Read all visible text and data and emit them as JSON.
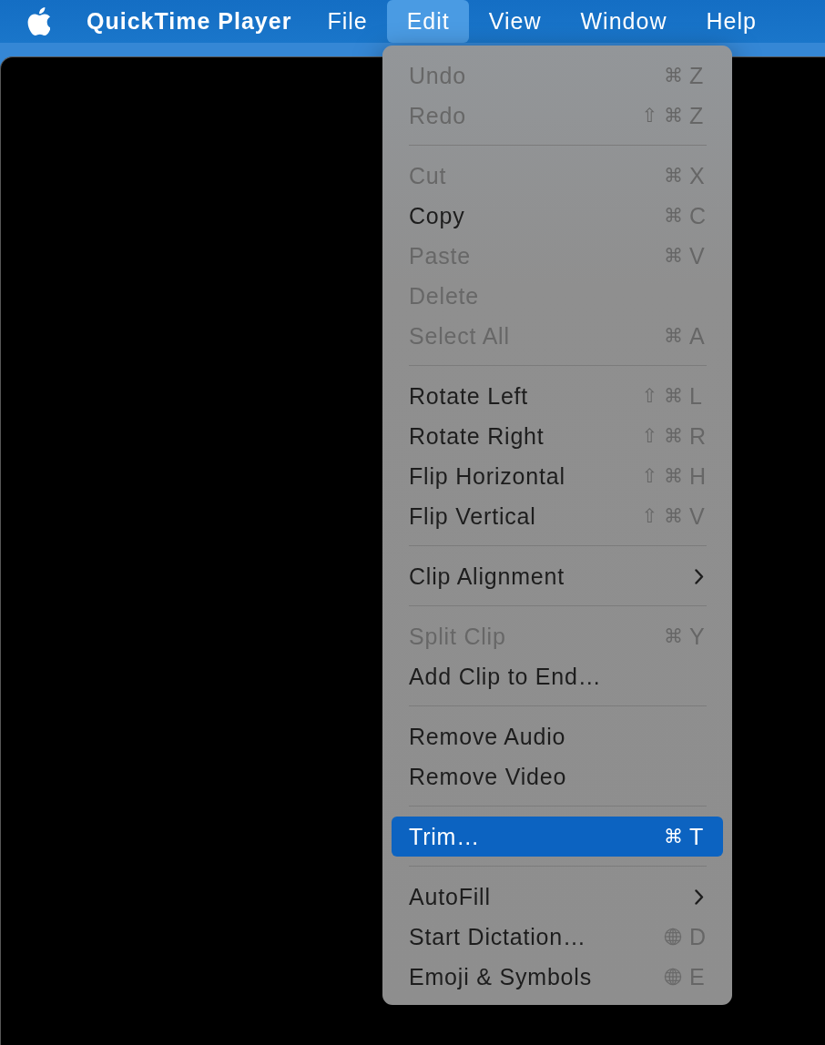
{
  "menu_bar": {
    "app_name": "QuickTime Player",
    "menus": [
      {
        "label": "File",
        "selected": false
      },
      {
        "label": "Edit",
        "selected": true
      },
      {
        "label": "View",
        "selected": false
      },
      {
        "label": "Window",
        "selected": false
      },
      {
        "label": "Help",
        "selected": false
      }
    ]
  },
  "edit_menu": {
    "groups": [
      {
        "items": [
          {
            "label": "Undo",
            "kind": "command",
            "disabled": true,
            "selected": false,
            "shortcut": {
              "kind": "modifiers",
              "modifiers": "⌘",
              "key": "Z"
            }
          },
          {
            "label": "Redo",
            "kind": "command",
            "disabled": true,
            "selected": false,
            "shortcut": {
              "kind": "modifiers",
              "modifiers": "⇧ ⌘",
              "key": "Z"
            }
          }
        ]
      },
      {
        "items": [
          {
            "label": "Cut",
            "kind": "command",
            "disabled": true,
            "selected": false,
            "shortcut": {
              "kind": "modifiers",
              "modifiers": "⌘",
              "key": "X"
            }
          },
          {
            "label": "Copy",
            "kind": "command",
            "disabled": false,
            "selected": false,
            "shortcut": {
              "kind": "modifiers",
              "modifiers": "⌘",
              "key": "C"
            }
          },
          {
            "label": "Paste",
            "kind": "command",
            "disabled": true,
            "selected": false,
            "shortcut": {
              "kind": "modifiers",
              "modifiers": "⌘",
              "key": "V"
            }
          },
          {
            "label": "Delete",
            "kind": "command",
            "disabled": true,
            "selected": false
          },
          {
            "label": "Select All",
            "kind": "command",
            "disabled": true,
            "selected": false,
            "shortcut": {
              "kind": "modifiers",
              "modifiers": "⌘",
              "key": "A"
            }
          }
        ]
      },
      {
        "items": [
          {
            "label": "Rotate Left",
            "kind": "command",
            "disabled": false,
            "selected": false,
            "shortcut": {
              "kind": "modifiers",
              "modifiers": "⇧ ⌘",
              "key": "L"
            }
          },
          {
            "label": "Rotate Right",
            "kind": "command",
            "disabled": false,
            "selected": false,
            "shortcut": {
              "kind": "modifiers",
              "modifiers": "⇧ ⌘",
              "key": "R"
            }
          },
          {
            "label": "Flip Horizontal",
            "kind": "command",
            "disabled": false,
            "selected": false,
            "shortcut": {
              "kind": "modifiers",
              "modifiers": "⇧ ⌘",
              "key": "H"
            }
          },
          {
            "label": "Flip Vertical",
            "kind": "command",
            "disabled": false,
            "selected": false,
            "shortcut": {
              "kind": "modifiers",
              "modifiers": "⇧ ⌘",
              "key": "V"
            }
          }
        ]
      },
      {
        "items": [
          {
            "label": "Clip Alignment",
            "kind": "submenu",
            "disabled": false,
            "selected": false
          }
        ]
      },
      {
        "items": [
          {
            "label": "Split Clip",
            "kind": "command",
            "disabled": true,
            "selected": false,
            "shortcut": {
              "kind": "modifiers",
              "modifiers": "⌘",
              "key": "Y"
            }
          },
          {
            "label": "Add Clip to End…",
            "kind": "command",
            "disabled": false,
            "selected": false
          }
        ]
      },
      {
        "items": [
          {
            "label": "Remove Audio",
            "kind": "command",
            "disabled": false,
            "selected": false
          },
          {
            "label": "Remove Video",
            "kind": "command",
            "disabled": false,
            "selected": false
          }
        ]
      },
      {
        "items": [
          {
            "label": "Trim…",
            "kind": "command",
            "disabled": false,
            "selected": true,
            "shortcut": {
              "kind": "modifiers",
              "modifiers": "⌘",
              "key": "T"
            }
          }
        ]
      },
      {
        "items": [
          {
            "label": "AutoFill",
            "kind": "submenu",
            "disabled": false,
            "selected": false
          },
          {
            "label": "Start Dictation…",
            "kind": "command",
            "disabled": false,
            "selected": false,
            "shortcut": {
              "kind": "function",
              "key": "D"
            }
          },
          {
            "label": "Emoji & Symbols",
            "kind": "command",
            "disabled": false,
            "selected": false,
            "shortcut": {
              "kind": "function",
              "key": "E"
            }
          }
        ]
      }
    ]
  }
}
